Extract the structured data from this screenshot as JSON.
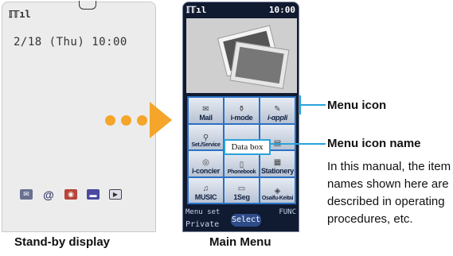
{
  "standby": {
    "signal": "𝕀𝕋ıl",
    "clock": "2/18 (Thu) 10:00",
    "dock_icons": [
      "mail-icon",
      "imode-icon",
      "iappli-icon",
      "bar-icon",
      "play-icon"
    ],
    "caption": "Stand-by display"
  },
  "main_menu": {
    "signal": "𝕀𝕋ıl",
    "time": "10:00",
    "items": [
      {
        "label": "Mail",
        "icon": "envelope-icon"
      },
      {
        "label": "i-mode",
        "icon": "imode-icon"
      },
      {
        "label": "i-αppli",
        "icon": "iappli-icon"
      },
      {
        "label": "Set./Service",
        "icon": "settings-icon"
      },
      {
        "label": "",
        "icon": "databox-icon"
      },
      {
        "label": "",
        "icon": "drawer-icon"
      },
      {
        "label": "i-concier",
        "icon": "concier-icon"
      },
      {
        "label": "Phonebook",
        "icon": "phonebook-icon"
      },
      {
        "label": "Stationery",
        "icon": "stationery-icon"
      },
      {
        "label": "MUSIC",
        "icon": "headphones-icon"
      },
      {
        "label": "1Seg",
        "icon": "tv-icon"
      },
      {
        "label": "Osaifu-Keitai",
        "icon": "wallet-icon"
      }
    ],
    "highlighted_name": "Data box",
    "softkeys": {
      "menu_set": "Menu set",
      "private": "Private",
      "select": "Select",
      "func": "FUNC"
    },
    "caption": "Main Menu"
  },
  "callouts": {
    "menu_icon": "Menu icon",
    "menu_icon_name": "Menu icon name",
    "description": "In this manual, the item names shown here are described in operating procedures, etc."
  },
  "colors": {
    "accent": "#f4a52a",
    "highlight": "#2aa2dc",
    "grid": "#2a71c6"
  }
}
